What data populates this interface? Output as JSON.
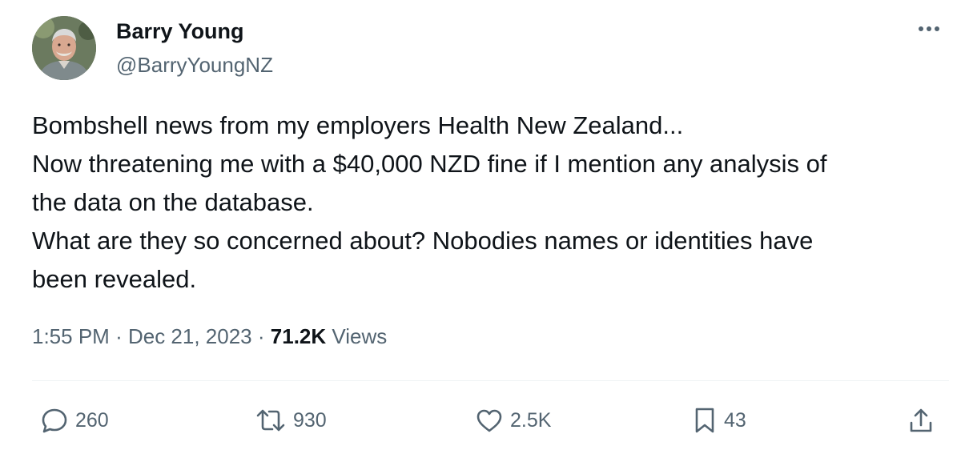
{
  "author": {
    "name": "Barry Young",
    "handle": "@BarryYoungNZ"
  },
  "tweet": {
    "lines": [
      "Bombshell news from my employers Health New Zealand...",
      "Now threatening me with a $40,000 NZD fine if I mention any analysis of",
      "the data on the database.",
      "What are they so concerned about?  Nobodies names or identities have",
      "been revealed."
    ],
    "time": "1:55 PM",
    "date": "Dec 21, 2023",
    "separator": "·",
    "views_count": "71.2K",
    "views_label": "Views"
  },
  "actions": {
    "replies": "260",
    "reposts": "930",
    "likes": "2.5K",
    "bookmarks": "43"
  },
  "icons": {
    "more": "more-horizontal-icon",
    "reply": "reply-bubble-icon",
    "repost": "repost-icon",
    "like": "heart-icon",
    "bookmark": "bookmark-icon",
    "share": "share-icon"
  },
  "colors": {
    "text": "#0f1419",
    "secondary": "#536471",
    "divider": "#eff3f4"
  }
}
